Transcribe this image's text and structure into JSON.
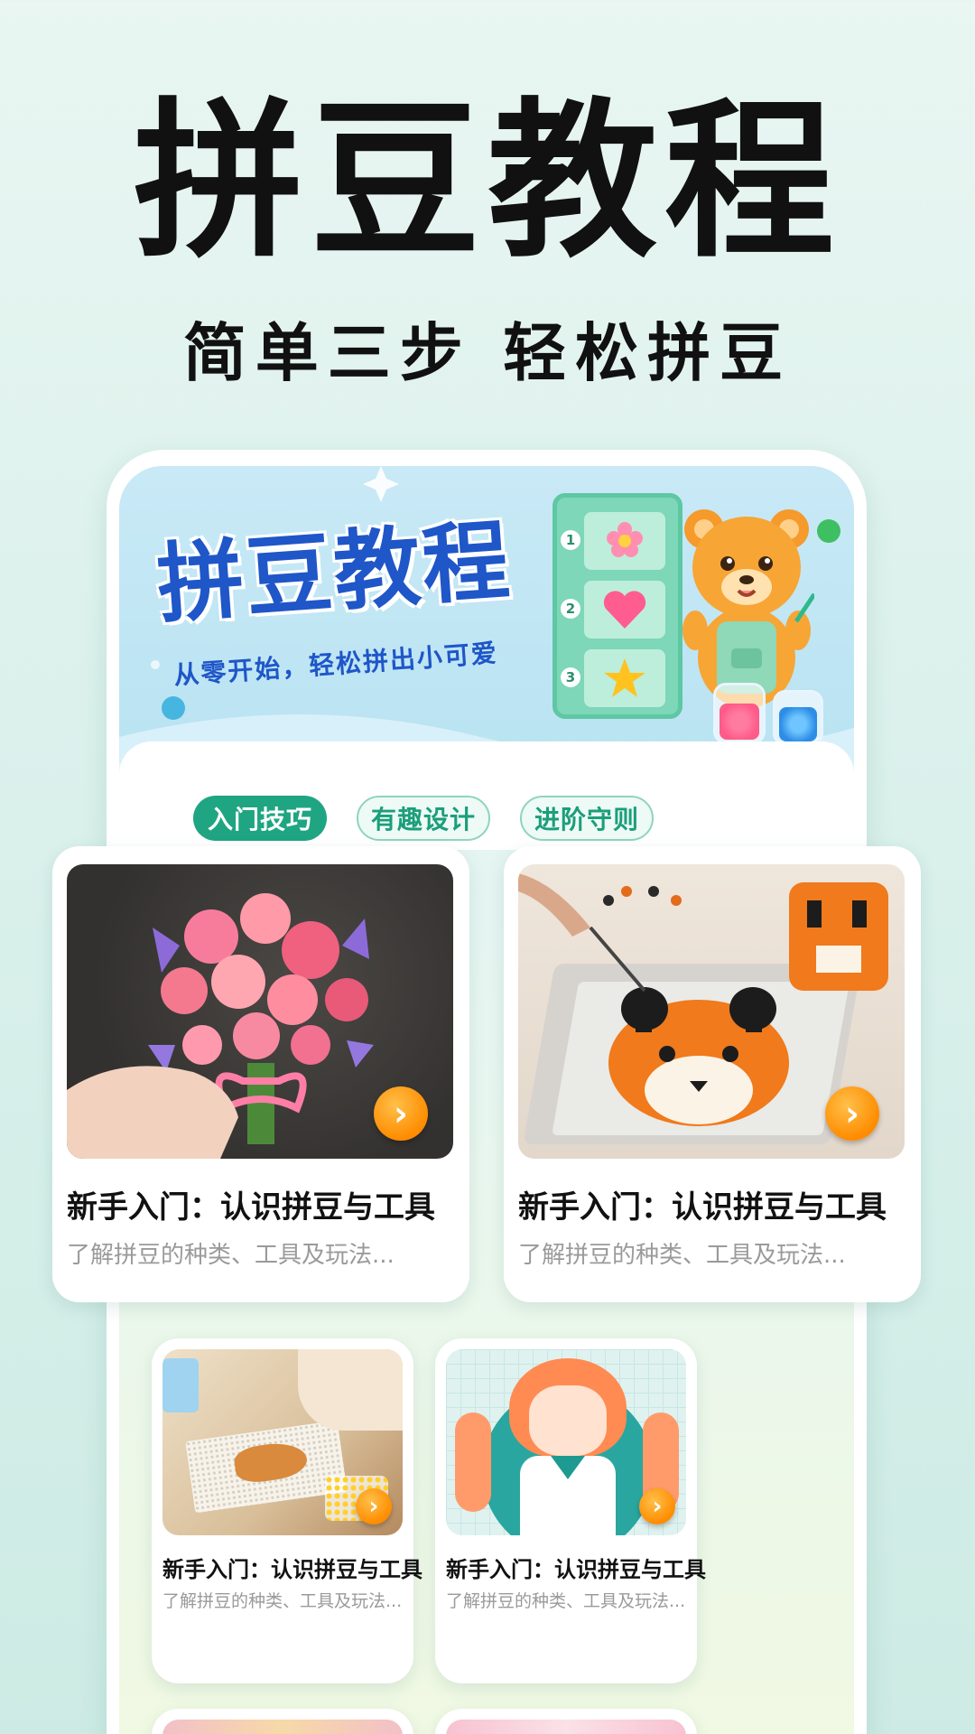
{
  "hero": {
    "title": "拼豆教程",
    "subtitle": "简单三步 轻松拼豆"
  },
  "banner": {
    "title": "拼豆教程",
    "subtitle": "从零开始，轻松拼出小可爱",
    "steps": [
      {
        "num": "1",
        "icon": "flower-icon"
      },
      {
        "num": "2",
        "icon": "heart-icon"
      },
      {
        "num": "3",
        "icon": "star-icon"
      }
    ]
  },
  "tabs": [
    {
      "label": "入门技巧",
      "active": true
    },
    {
      "label": "有趣设计",
      "active": false
    },
    {
      "label": "进阶守则",
      "active": false
    }
  ],
  "cards": [
    {
      "title": "新手入门：认识拼豆与工具",
      "desc": "了解拼豆的种类、工具及玩法...",
      "image": "flower-bouquet-bead-art"
    },
    {
      "title": "新手入门：认识拼豆与工具",
      "desc": "了解拼豆的种类、工具及玩法...",
      "image": "tiger-bead-art"
    },
    {
      "title": "新手入门：认识拼豆与工具",
      "desc": "了解拼豆的种类、工具及玩法...",
      "image": "world-map-bead-pegboard"
    },
    {
      "title": "新手入门：认识拼豆与工具",
      "desc": "了解拼豆的种类、工具及玩法...",
      "image": "anime-girl-pixel-art"
    }
  ],
  "colors": {
    "accent": "#1fa582",
    "banner_title": "#1f56c8",
    "arrow": "#ff8c00"
  }
}
